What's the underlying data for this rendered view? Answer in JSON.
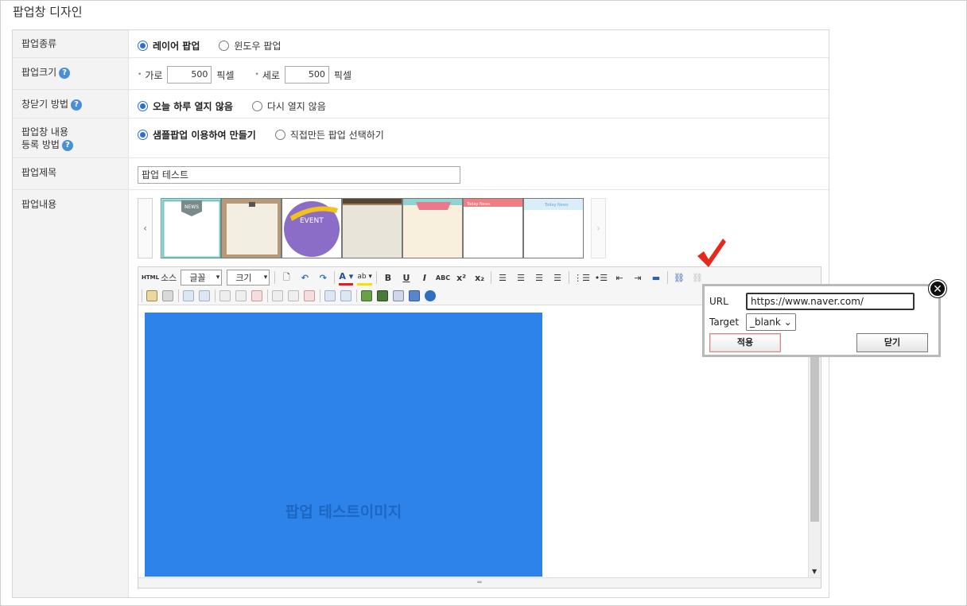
{
  "page": {
    "title": "팝업창 디자인"
  },
  "rows": {
    "type": {
      "label": "팝업종류",
      "options": [
        "레이어 팝업",
        "윈도우 팝업"
      ],
      "selected": "레이어 팝업"
    },
    "size": {
      "label": "팝업크기",
      "width_label": "가로",
      "width_value": "500",
      "height_label": "세로",
      "height_value": "500",
      "unit": "픽셀"
    },
    "close": {
      "label": "창닫기 방법",
      "options": [
        "오늘 하루 열지 않음",
        "다시 열지 않음"
      ],
      "selected": "오늘 하루 열지 않음"
    },
    "register": {
      "label_line1": "팝업창 내용",
      "label_line2": "등록 방법",
      "options": [
        "샘플팝업 이용하여 만들기",
        "직접만든 팝업 선택하기"
      ],
      "selected": "샘플팝업 이용하여 만들기"
    },
    "title": {
      "label": "팝업제목",
      "value": "팝업 테스트"
    },
    "content": {
      "label": "팝업내용"
    }
  },
  "thumbnails": [
    "NEWS",
    "",
    "EVENT",
    "",
    "",
    "Today News",
    "Today News"
  ],
  "toolbar": {
    "html_label": "HTML",
    "source_label": "소스",
    "font_select": "글꼴",
    "size_select": "크기",
    "bold": "B",
    "underline": "U",
    "italic": "I",
    "strike": "ABC",
    "sup": "x²",
    "sub": "x₂"
  },
  "editor": {
    "canvas_text": "팝업 테스트이미지",
    "canvas_color": "#2d83ea"
  },
  "link_popup": {
    "url_label": "URL",
    "url_value": "https://www.naver.com/",
    "target_label": "Target",
    "target_value": "_blank",
    "apply_label": "적용",
    "close_label": "닫기"
  },
  "colors": {
    "accent": "#2b6fd4",
    "help": "#4a8fd6",
    "checkmark": "#e8281c"
  }
}
